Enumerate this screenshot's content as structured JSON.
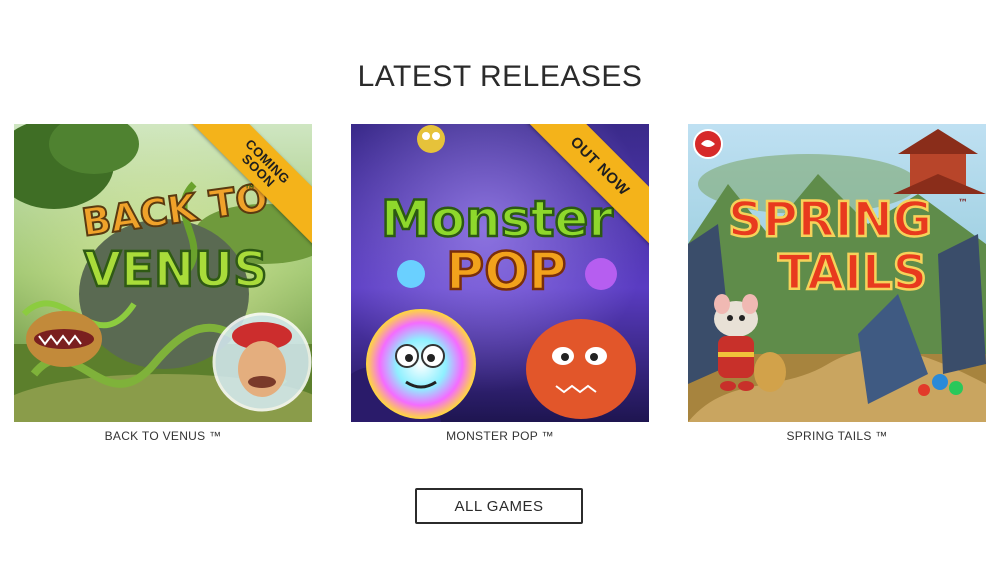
{
  "section": {
    "title": "LATEST RELEASES"
  },
  "games": [
    {
      "caption": "BACK TO VENUS ™",
      "ribbon": "COMING\nSOON",
      "logo_line1": "BACK TO",
      "logo_line2": "VENUS",
      "logo_tm": "™"
    },
    {
      "caption": "MONSTER POP ™",
      "ribbon": "OUT NOW",
      "logo_line1": "Monster",
      "logo_line2": "POP"
    },
    {
      "caption": "SPRING TAILS ™",
      "logo_line1": "SPRING",
      "logo_line2": "TAILS",
      "logo_tm": "™"
    }
  ],
  "button": {
    "all_games_label": "ALL GAMES"
  },
  "colors": {
    "ribbon": "#f4b31a",
    "text": "#2b2b2b"
  }
}
